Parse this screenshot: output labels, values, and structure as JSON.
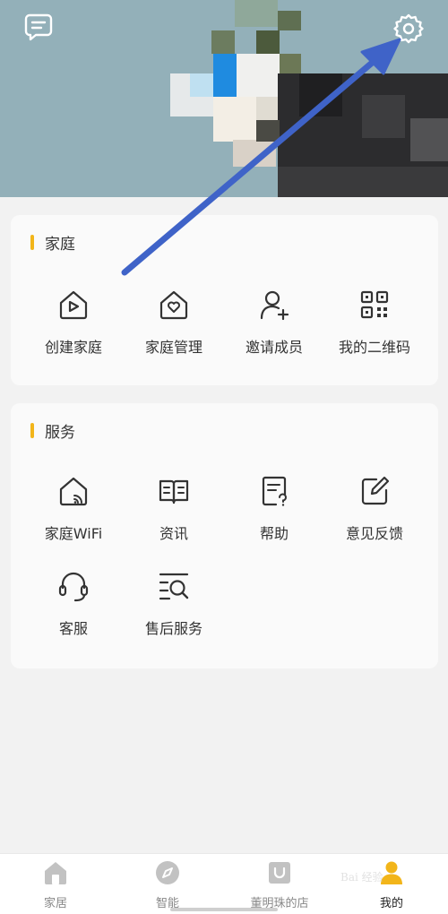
{
  "header": {
    "message_icon": "message-icon",
    "settings_icon": "gear-icon"
  },
  "family": {
    "title": "家庭",
    "items": [
      {
        "label": "创建家庭",
        "icon": "home-play-icon"
      },
      {
        "label": "家庭管理",
        "icon": "home-heart-icon"
      },
      {
        "label": "邀请成员",
        "icon": "user-add-icon"
      },
      {
        "label": "我的二维码",
        "icon": "qrcode-icon"
      }
    ]
  },
  "services": {
    "title": "服务",
    "items": [
      {
        "label": "家庭WiFi",
        "icon": "home-wifi-icon"
      },
      {
        "label": "资讯",
        "icon": "book-icon"
      },
      {
        "label": "帮助",
        "icon": "help-doc-icon"
      },
      {
        "label": "意见反馈",
        "icon": "feedback-edit-icon"
      },
      {
        "label": "客服",
        "icon": "headset-icon"
      },
      {
        "label": "售后服务",
        "icon": "search-list-icon"
      }
    ]
  },
  "tabbar": {
    "items": [
      {
        "label": "家居",
        "icon": "house-icon",
        "active": false
      },
      {
        "label": "智能",
        "icon": "compass-icon",
        "active": false
      },
      {
        "label": "董明珠的店",
        "icon": "shop-bag-icon",
        "active": false
      },
      {
        "label": "我的",
        "icon": "person-icon",
        "active": true
      }
    ]
  },
  "watermark": "Bai 经验",
  "colors": {
    "accent": "#f2b51a",
    "arrow": "#3f63c8",
    "header_bg": "#93b0b9"
  }
}
